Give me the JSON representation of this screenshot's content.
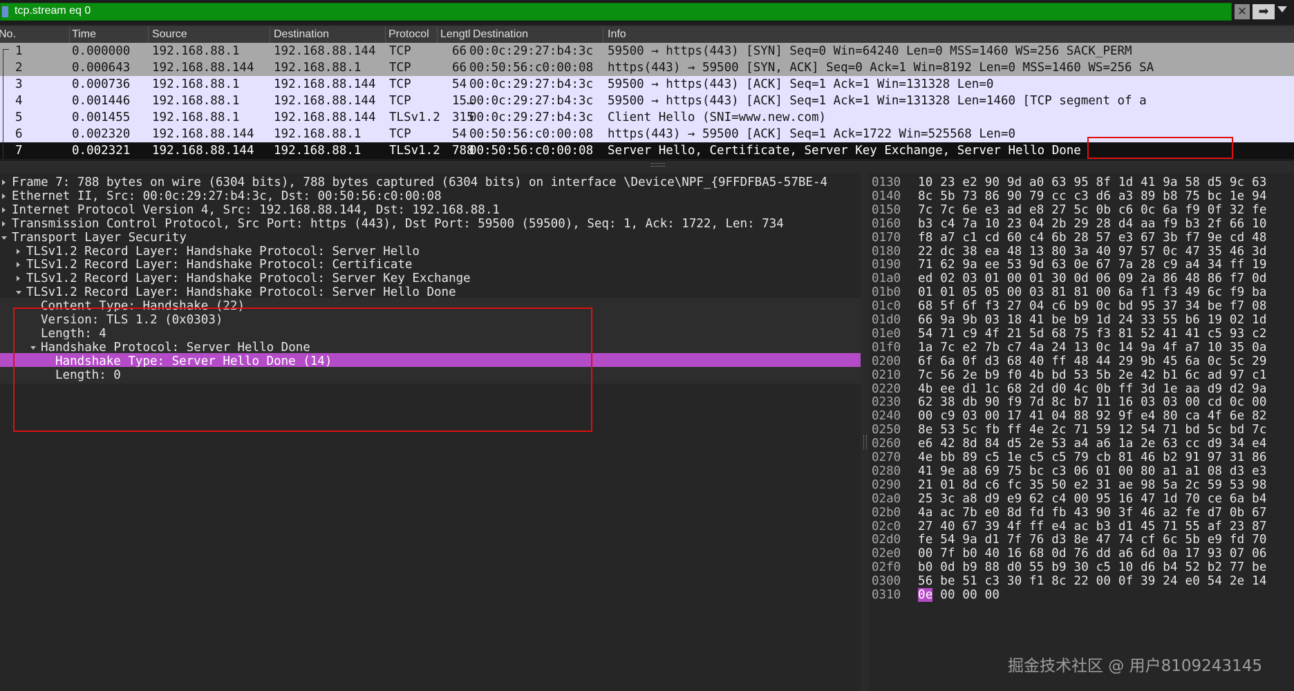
{
  "filter": {
    "text": "tcp.stream eq 0",
    "bg_color": "#0b8f10",
    "clear_icon": "x-icon",
    "apply_icon": "arrow-right-icon",
    "clear_glyph": "✕",
    "apply_glyph": "➡"
  },
  "columns": [
    "No.",
    "Time",
    "Source",
    "Destination",
    "Protocol",
    "Lengtl",
    "Destination",
    "Info"
  ],
  "packets": [
    {
      "no": "1",
      "time": "0.000000",
      "src": "192.168.88.1",
      "dst": "192.168.88.144",
      "proto": "TCP",
      "len": "66",
      "dst2": "00:0c:29:27:b4:3c",
      "info": "59500 → https(443) [SYN] Seq=0 Win=64240 Len=0 MSS=1460 WS=256 SACK_PERM",
      "style": "grey"
    },
    {
      "no": "2",
      "time": "0.000643",
      "src": "192.168.88.144",
      "dst": "192.168.88.1",
      "proto": "TCP",
      "len": "66",
      "dst2": "00:50:56:c0:00:08",
      "info": "https(443) → 59500 [SYN, ACK] Seq=0 Ack=1 Win=8192 Len=0 MSS=1460 WS=256 SA",
      "style": "grey"
    },
    {
      "no": "3",
      "time": "0.000736",
      "src": "192.168.88.1",
      "dst": "192.168.88.144",
      "proto": "TCP",
      "len": "54",
      "dst2": "00:0c:29:27:b4:3c",
      "info": "59500 → https(443) [ACK] Seq=1 Ack=1 Win=131328 Len=0",
      "style": "light"
    },
    {
      "no": "4",
      "time": "0.001446",
      "src": "192.168.88.1",
      "dst": "192.168.88.144",
      "proto": "TCP",
      "len": "15…",
      "dst2": "00:0c:29:27:b4:3c",
      "info": "59500 → https(443) [ACK] Seq=1 Ack=1 Win=131328 Len=1460 [TCP segment of a",
      "style": "light"
    },
    {
      "no": "5",
      "time": "0.001455",
      "src": "192.168.88.1",
      "dst": "192.168.88.144",
      "proto": "TLSv1.2",
      "len": "315",
      "dst2": "00:0c:29:27:b4:3c",
      "info": "Client Hello (SNI=www.new.com)",
      "style": "light"
    },
    {
      "no": "6",
      "time": "0.002320",
      "src": "192.168.88.144",
      "dst": "192.168.88.1",
      "proto": "TCP",
      "len": "54",
      "dst2": "00:50:56:c0:00:08",
      "info": "https(443) → 59500 [ACK] Seq=1 Ack=1722 Win=525568 Len=0",
      "style": "light"
    },
    {
      "no": "7",
      "time": "0.002321",
      "src": "192.168.88.144",
      "dst": "192.168.88.1",
      "proto": "TLSv1.2",
      "len": "788",
      "dst2": "00:50:56:c0:00:08",
      "info": "Server Hello, Certificate, Server Key Exchange, Server Hello Done",
      "style": "selected"
    }
  ],
  "details": [
    {
      "text": "Frame 7: 788 bytes on wire (6304 bits), 788 bytes captured (6304 bits) on interface \\Device\\NPF_{9FFDFBA5-57BE-4",
      "indent": 0,
      "toggle": "collapsed"
    },
    {
      "text": "Ethernet II, Src: 00:0c:29:27:b4:3c, Dst: 00:50:56:c0:00:08",
      "indent": 0,
      "toggle": "collapsed"
    },
    {
      "text": "Internet Protocol Version 4, Src: 192.168.88.144, Dst: 192.168.88.1",
      "indent": 0,
      "toggle": "collapsed"
    },
    {
      "text": "Transmission Control Protocol, Src Port: https (443), Dst Port: 59500 (59500), Seq: 1, Ack: 1722, Len: 734",
      "indent": 0,
      "toggle": "collapsed"
    },
    {
      "text": "Transport Layer Security",
      "indent": 0,
      "toggle": "expanded"
    },
    {
      "text": "TLSv1.2 Record Layer: Handshake Protocol: Server Hello",
      "indent": 1,
      "toggle": "collapsed"
    },
    {
      "text": "TLSv1.2 Record Layer: Handshake Protocol: Certificate",
      "indent": 1,
      "toggle": "collapsed"
    },
    {
      "text": "TLSv1.2 Record Layer: Handshake Protocol: Server Key Exchange",
      "indent": 1,
      "toggle": "collapsed"
    },
    {
      "text": "TLSv1.2 Record Layer: Handshake Protocol: Server Hello Done",
      "indent": 1,
      "toggle": "expanded"
    },
    {
      "text": "Content Type: Handshake (22)",
      "indent": 2,
      "toggle": "none"
    },
    {
      "text": "Version: TLS 1.2 (0x0303)",
      "indent": 2,
      "toggle": "none"
    },
    {
      "text": "Length: 4",
      "indent": 2,
      "toggle": "none"
    },
    {
      "text": "Handshake Protocol: Server Hello Done",
      "indent": 2,
      "toggle": "expanded"
    },
    {
      "text": "Handshake Type: Server Hello Done (14)",
      "indent": 3,
      "toggle": "none",
      "selected": true
    },
    {
      "text": "Length: 0",
      "indent": 3,
      "toggle": "none"
    }
  ],
  "bytes": [
    {
      "offset": "0130",
      "hex": "10 23 e2 90 9d a0 63 95  8f 1d 41 9a 58 d5 9c 63"
    },
    {
      "offset": "0140",
      "hex": "8c 5b 73 86 90 79 cc c3  d6 a3 89 b8 75 bc 1e 94"
    },
    {
      "offset": "0150",
      "hex": "7c 7c 6e e3 ad e8 27 5c  0b c6 0c 6a f9 0f 32 fe"
    },
    {
      "offset": "0160",
      "hex": "b3 c4 7a 10 23 04 2b 29  28 d4 aa f9 b3 2f 66 10"
    },
    {
      "offset": "0170",
      "hex": "f8 a7 c1 cd 60 c4 6b 28  57 e3 67 3b f7 9e cd 48"
    },
    {
      "offset": "0180",
      "hex": "22 dc 38 ea 48 13 80 3a  40 97 57 0c 47 35 46 3d"
    },
    {
      "offset": "0190",
      "hex": "71 62 9a ee 53 9d 63 0e  67 7a 28 c9 a4 34 ff 19"
    },
    {
      "offset": "01a0",
      "hex": "ed 02 03 01 00 01 30 0d  06 09 2a 86 48 86 f7 0d"
    },
    {
      "offset": "01b0",
      "hex": "01 01 05 05 00 03 81 81  00 6a f1 f3 49 6c f9 ba"
    },
    {
      "offset": "01c0",
      "hex": "68 5f 6f f3 27 04 c6 b9  0c bd 95 37 34 be f7 08"
    },
    {
      "offset": "01d0",
      "hex": "66 9a 9b 03 18 41 be b9  1d 24 33 55 b6 19 02 1d"
    },
    {
      "offset": "01e0",
      "hex": "54 71 c9 4f 21 5d 68 75  f3 81 52 41 41 c5 93 c2"
    },
    {
      "offset": "01f0",
      "hex": "1a 7c e2 7b c7 4a 24 13  0c 14 9a 4f a7 10 35 0a"
    },
    {
      "offset": "0200",
      "hex": "6f 6a 0f d3 68 40 ff 48  44 29 9b 45 6a 0c 5c 29"
    },
    {
      "offset": "0210",
      "hex": "7c 56 2e b9 f0 4b bd 53  5b 2e 42 b1 6c ad 97 c1"
    },
    {
      "offset": "0220",
      "hex": "4b ee d1 1c 68 2d d0 4c  0b ff 3d 1e aa d9 d2 9a"
    },
    {
      "offset": "0230",
      "hex": "62 38 db 90 f9 7d 8c b7  11 16 03 03 00 cd 0c 00"
    },
    {
      "offset": "0240",
      "hex": "00 c9 03 00 17 41 04 88  92 9f e4 80 ca 4f 6e 82"
    },
    {
      "offset": "0250",
      "hex": "8e 53 5c fb ff 4e 2c 71  59 12 54 71 bd 5c bd 7c"
    },
    {
      "offset": "0260",
      "hex": "e6 42 8d 84 d5 2e 53 a4  a6 1a 2e 63 cc d9 34 e4"
    },
    {
      "offset": "0270",
      "hex": "4e bb 89 c5 1e c5 c5 79  cb 81 46 b2 91 97 31 86"
    },
    {
      "offset": "0280",
      "hex": "41 9e a8 69 75 bc c3 06  01 00 80 a1 a1 08 d3 e3"
    },
    {
      "offset": "0290",
      "hex": "21 01 8d c6 fc 35 50 e2  31 ae 98 5a 2c 59 53 98"
    },
    {
      "offset": "02a0",
      "hex": "25 3c a8 d9 e9 62 c4 00  95 16 47 1d 70 ce 6a b4"
    },
    {
      "offset": "02b0",
      "hex": "4a ac 7b e0 8d fd fb 43  90 3f 46 a2 fe d7 0b 67"
    },
    {
      "offset": "02c0",
      "hex": "27 40 67 39 4f ff e4 ac  b3 d1 45 71 55 af 23 87"
    },
    {
      "offset": "02d0",
      "hex": "fe 54 9a d1 7f 76 d3 8e  47 74 cf 6c 5b e9 fd 70"
    },
    {
      "offset": "02e0",
      "hex": "00 7f b0 40 16 68 0d 76  dd a6 6d 0a 17 93 07 06"
    },
    {
      "offset": "02f0",
      "hex": "b0 0d b9 88 d0 55 b9 30  c5 10 d6 b4 52 b2 77 be"
    },
    {
      "offset": "0300",
      "hex": "56 be 51 c3 30 f1 8c 22  00 0f 39 24 e0 54 2e 14"
    },
    {
      "offset": "0310",
      "hex_selected": "0e",
      "hex": " 00 00 00"
    }
  ],
  "watermark": "掘金技术社区 @ 用户8109243145",
  "colors": {
    "selected_row": "#111111",
    "highlight_field": "#b44cc7",
    "annotation_box": "#e01010",
    "grey_row": "#a8a8a8",
    "light_row": "#e4e2ff"
  }
}
